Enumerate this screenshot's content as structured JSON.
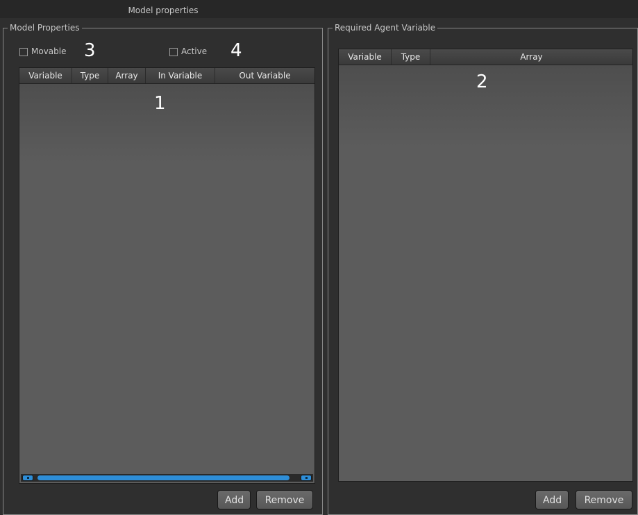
{
  "window": {
    "title": "Model properties"
  },
  "left_panel": {
    "group_title": "Model Properties",
    "movable_label": "Movable",
    "active_label": "Active",
    "movable_checked": false,
    "active_checked": false,
    "table_headers": [
      "Variable",
      "Type",
      "Array",
      "In Variable",
      "Out Variable"
    ],
    "add_label": "Add",
    "remove_label": "Remove"
  },
  "right_panel": {
    "group_title": "Required Agent Variable",
    "table_headers": [
      "Variable",
      "Type",
      "Array"
    ],
    "add_label": "Add",
    "remove_label": "Remove"
  },
  "annotations": {
    "n1": "1",
    "n2": "2",
    "n3": "3",
    "n4": "4"
  },
  "colors": {
    "accent": "#2e8ed8",
    "background": "#2f2f2f",
    "table_bg": "#5a5a5a"
  }
}
